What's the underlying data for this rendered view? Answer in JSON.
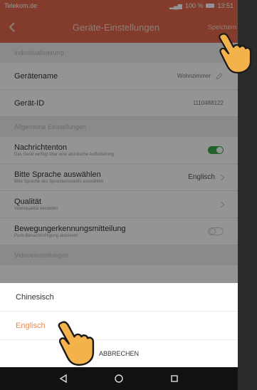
{
  "status": {
    "carrier": "Telekom.de",
    "battery": "100 %",
    "time": "13:51"
  },
  "appbar": {
    "title": "Geräte-Einstellungen",
    "save": "Speichern"
  },
  "sections": {
    "personal": "Individualisierung",
    "general": "Allgemeine Einstellungen",
    "video": "Videoeinstellungen"
  },
  "rows": {
    "device_name": {
      "label": "Gerätename",
      "value": "Wohnzimmer"
    },
    "device_id": {
      "label": "Gerät-ID",
      "value": "1110488122"
    },
    "notify_tone": {
      "label": "Nachrichtenton",
      "sub": "Das Gerät verfügt über eine akustische Aufforderung",
      "on": true
    },
    "language": {
      "label": "Bitte Sprache auswählen",
      "sub": "Bitte Sprache des Sprachassistents auswählen",
      "value": "Englisch"
    },
    "quality": {
      "label": "Qualität",
      "sub": "Videoqualität einstellen"
    },
    "motion": {
      "label": "Bewegungerkennungsmitteilung",
      "sub": "Push-Benachrichtigung aktivieren",
      "on": false
    }
  },
  "sheet": {
    "options": [
      "Chinesisch",
      "Englisch"
    ],
    "selected": "Englisch",
    "cancel": "ABBRECHEN"
  },
  "colors": {
    "accent": "#e2674a",
    "toggle_on": "#3aa74a",
    "selected_option": "#e88a5a"
  }
}
